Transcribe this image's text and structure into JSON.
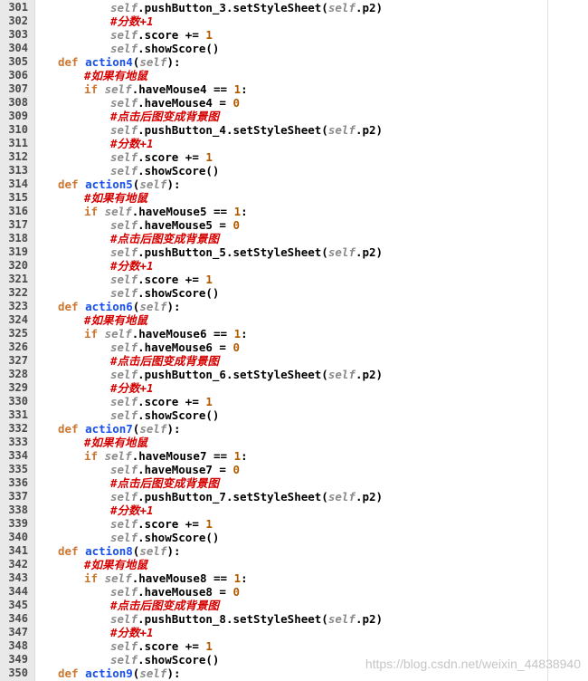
{
  "editor": {
    "watermark": "https://blog.csdn.net/weixin_44838940",
    "colors": {
      "gutter": "#e9e9e9",
      "keyword": "#cc7832",
      "self": "#8a8a8a",
      "function": "#1750eb",
      "number": "#b05a00",
      "comment": "#d60000"
    },
    "lines": [
      {
        "n": "301",
        "indent": 2,
        "tokens": [
          [
            "self",
            "self"
          ],
          [
            "",
            ".pushButton_3.setStyleSheet("
          ],
          [
            "self",
            "self"
          ],
          [
            "",
            ".p2)"
          ]
        ]
      },
      {
        "n": "302",
        "indent": 2,
        "tokens": [
          [
            "cm",
            "#分数+1"
          ]
        ]
      },
      {
        "n": "303",
        "indent": 2,
        "tokens": [
          [
            "self",
            "self"
          ],
          [
            "",
            ".score += "
          ],
          [
            "num",
            "1"
          ]
        ]
      },
      {
        "n": "304",
        "indent": 2,
        "tokens": [
          [
            "self",
            "self"
          ],
          [
            "",
            ".showScore()"
          ]
        ]
      },
      {
        "n": "305",
        "indent": 0,
        "tokens": [
          [
            "kw",
            "def "
          ],
          [
            "fn",
            "action4"
          ],
          [
            "",
            "("
          ],
          [
            "self",
            "self"
          ],
          [
            "",
            "):"
          ]
        ]
      },
      {
        "n": "306",
        "indent": 1,
        "tokens": [
          [
            "cm",
            "#如果有地鼠"
          ]
        ]
      },
      {
        "n": "307",
        "indent": 1,
        "tokens": [
          [
            "kw",
            "if "
          ],
          [
            "self",
            "self"
          ],
          [
            "",
            ".haveMouse4 == "
          ],
          [
            "num",
            "1"
          ],
          [
            "",
            ":"
          ]
        ]
      },
      {
        "n": "308",
        "indent": 2,
        "tokens": [
          [
            "self",
            "self"
          ],
          [
            "",
            ".haveMouse4 = "
          ],
          [
            "num",
            "0"
          ]
        ]
      },
      {
        "n": "309",
        "indent": 2,
        "tokens": [
          [
            "cm",
            "#点击后图变成背景图"
          ]
        ]
      },
      {
        "n": "310",
        "indent": 2,
        "tokens": [
          [
            "self",
            "self"
          ],
          [
            "",
            ".pushButton_4.setStyleSheet("
          ],
          [
            "self",
            "self"
          ],
          [
            "",
            ".p2)"
          ]
        ]
      },
      {
        "n": "311",
        "indent": 2,
        "tokens": [
          [
            "cm",
            "#分数+1"
          ]
        ]
      },
      {
        "n": "312",
        "indent": 2,
        "tokens": [
          [
            "self",
            "self"
          ],
          [
            "",
            ".score += "
          ],
          [
            "num",
            "1"
          ]
        ]
      },
      {
        "n": "313",
        "indent": 2,
        "tokens": [
          [
            "self",
            "self"
          ],
          [
            "",
            ".showScore()"
          ]
        ]
      },
      {
        "n": "314",
        "indent": 0,
        "tokens": [
          [
            "kw",
            "def "
          ],
          [
            "fn",
            "action5"
          ],
          [
            "",
            "("
          ],
          [
            "self",
            "self"
          ],
          [
            "",
            "):"
          ]
        ]
      },
      {
        "n": "315",
        "indent": 1,
        "tokens": [
          [
            "cm",
            "#如果有地鼠"
          ]
        ]
      },
      {
        "n": "316",
        "indent": 1,
        "tokens": [
          [
            "kw",
            "if "
          ],
          [
            "self",
            "self"
          ],
          [
            "",
            ".haveMouse5 == "
          ],
          [
            "num",
            "1"
          ],
          [
            "",
            ":"
          ]
        ]
      },
      {
        "n": "317",
        "indent": 2,
        "tokens": [
          [
            "self",
            "self"
          ],
          [
            "",
            ".haveMouse5 = "
          ],
          [
            "num",
            "0"
          ]
        ]
      },
      {
        "n": "318",
        "indent": 2,
        "tokens": [
          [
            "cm",
            "#点击后图变成背景图"
          ]
        ]
      },
      {
        "n": "319",
        "indent": 2,
        "tokens": [
          [
            "self",
            "self"
          ],
          [
            "",
            ".pushButton_5.setStyleSheet("
          ],
          [
            "self",
            "self"
          ],
          [
            "",
            ".p2)"
          ]
        ]
      },
      {
        "n": "320",
        "indent": 2,
        "tokens": [
          [
            "cm",
            "#分数+1"
          ]
        ]
      },
      {
        "n": "321",
        "indent": 2,
        "tokens": [
          [
            "self",
            "self"
          ],
          [
            "",
            ".score += "
          ],
          [
            "num",
            "1"
          ]
        ]
      },
      {
        "n": "322",
        "indent": 2,
        "tokens": [
          [
            "self",
            "self"
          ],
          [
            "",
            ".showScore()"
          ]
        ]
      },
      {
        "n": "323",
        "indent": 0,
        "tokens": [
          [
            "kw",
            "def "
          ],
          [
            "fn",
            "action6"
          ],
          [
            "",
            "("
          ],
          [
            "self",
            "self"
          ],
          [
            "",
            "):"
          ]
        ]
      },
      {
        "n": "324",
        "indent": 1,
        "tokens": [
          [
            "cm",
            "#如果有地鼠"
          ]
        ]
      },
      {
        "n": "325",
        "indent": 1,
        "tokens": [
          [
            "kw",
            "if "
          ],
          [
            "self",
            "self"
          ],
          [
            "",
            ".haveMouse6 == "
          ],
          [
            "num",
            "1"
          ],
          [
            "",
            ":"
          ]
        ]
      },
      {
        "n": "326",
        "indent": 2,
        "tokens": [
          [
            "self",
            "self"
          ],
          [
            "",
            ".haveMouse6 = "
          ],
          [
            "num",
            "0"
          ]
        ]
      },
      {
        "n": "327",
        "indent": 2,
        "tokens": [
          [
            "cm",
            "#点击后图变成背景图"
          ]
        ]
      },
      {
        "n": "328",
        "indent": 2,
        "tokens": [
          [
            "self",
            "self"
          ],
          [
            "",
            ".pushButton_6.setStyleSheet("
          ],
          [
            "self",
            "self"
          ],
          [
            "",
            ".p2)"
          ]
        ]
      },
      {
        "n": "329",
        "indent": 2,
        "tokens": [
          [
            "cm",
            "#分数+1"
          ]
        ]
      },
      {
        "n": "330",
        "indent": 2,
        "tokens": [
          [
            "self",
            "self"
          ],
          [
            "",
            ".score += "
          ],
          [
            "num",
            "1"
          ]
        ]
      },
      {
        "n": "331",
        "indent": 2,
        "tokens": [
          [
            "self",
            "self"
          ],
          [
            "",
            ".showScore()"
          ]
        ]
      },
      {
        "n": "332",
        "indent": 0,
        "tokens": [
          [
            "kw",
            "def "
          ],
          [
            "fn",
            "action7"
          ],
          [
            "",
            "("
          ],
          [
            "self",
            "self"
          ],
          [
            "",
            "):"
          ]
        ]
      },
      {
        "n": "333",
        "indent": 1,
        "tokens": [
          [
            "cm",
            "#如果有地鼠"
          ]
        ]
      },
      {
        "n": "334",
        "indent": 1,
        "tokens": [
          [
            "kw",
            "if "
          ],
          [
            "self",
            "self"
          ],
          [
            "",
            ".haveMouse7 == "
          ],
          [
            "num",
            "1"
          ],
          [
            "",
            ":"
          ]
        ]
      },
      {
        "n": "335",
        "indent": 2,
        "tokens": [
          [
            "self",
            "self"
          ],
          [
            "",
            ".haveMouse7 = "
          ],
          [
            "num",
            "0"
          ]
        ]
      },
      {
        "n": "336",
        "indent": 2,
        "tokens": [
          [
            "cm",
            "#点击后图变成背景图"
          ]
        ]
      },
      {
        "n": "337",
        "indent": 2,
        "tokens": [
          [
            "self",
            "self"
          ],
          [
            "",
            ".pushButton_7.setStyleSheet("
          ],
          [
            "self",
            "self"
          ],
          [
            "",
            ".p2)"
          ]
        ]
      },
      {
        "n": "338",
        "indent": 2,
        "tokens": [
          [
            "cm",
            "#分数+1"
          ]
        ]
      },
      {
        "n": "339",
        "indent": 2,
        "tokens": [
          [
            "self",
            "self"
          ],
          [
            "",
            ".score += "
          ],
          [
            "num",
            "1"
          ]
        ]
      },
      {
        "n": "340",
        "indent": 2,
        "tokens": [
          [
            "self",
            "self"
          ],
          [
            "",
            ".showScore()"
          ]
        ]
      },
      {
        "n": "341",
        "indent": 0,
        "tokens": [
          [
            "kw",
            "def "
          ],
          [
            "fn",
            "action8"
          ],
          [
            "",
            "("
          ],
          [
            "self",
            "self"
          ],
          [
            "",
            "):"
          ]
        ]
      },
      {
        "n": "342",
        "indent": 1,
        "tokens": [
          [
            "cm",
            "#如果有地鼠"
          ]
        ]
      },
      {
        "n": "343",
        "indent": 1,
        "tokens": [
          [
            "kw",
            "if "
          ],
          [
            "self",
            "self"
          ],
          [
            "",
            ".haveMouse8 == "
          ],
          [
            "num",
            "1"
          ],
          [
            "",
            ":"
          ]
        ]
      },
      {
        "n": "344",
        "indent": 2,
        "tokens": [
          [
            "self",
            "self"
          ],
          [
            "",
            ".haveMouse8 = "
          ],
          [
            "num",
            "0"
          ]
        ]
      },
      {
        "n": "345",
        "indent": 2,
        "tokens": [
          [
            "cm",
            "#点击后图变成背景图"
          ]
        ]
      },
      {
        "n": "346",
        "indent": 2,
        "tokens": [
          [
            "self",
            "self"
          ],
          [
            "",
            ".pushButton_8.setStyleSheet("
          ],
          [
            "self",
            "self"
          ],
          [
            "",
            ".p2)"
          ]
        ]
      },
      {
        "n": "347",
        "indent": 2,
        "tokens": [
          [
            "cm",
            "#分数+1"
          ]
        ]
      },
      {
        "n": "348",
        "indent": 2,
        "tokens": [
          [
            "self",
            "self"
          ],
          [
            "",
            ".score += "
          ],
          [
            "num",
            "1"
          ]
        ]
      },
      {
        "n": "349",
        "indent": 2,
        "tokens": [
          [
            "self",
            "self"
          ],
          [
            "",
            ".showScore()"
          ]
        ]
      },
      {
        "n": "350",
        "indent": 0,
        "tokens": [
          [
            "kw",
            "def "
          ],
          [
            "fn",
            "action9"
          ],
          [
            "",
            "("
          ],
          [
            "self",
            "self"
          ],
          [
            "",
            "):"
          ]
        ]
      }
    ]
  }
}
